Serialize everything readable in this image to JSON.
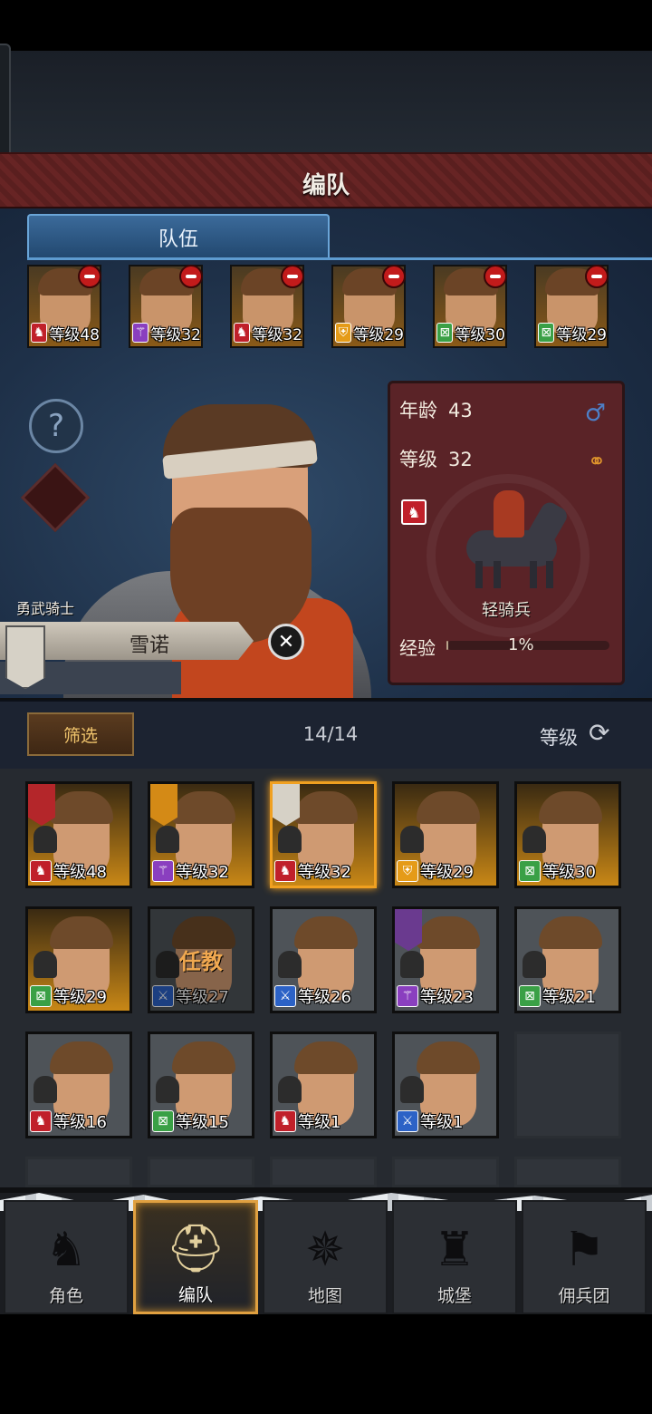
{
  "header": {
    "title": "编队"
  },
  "team_panel": {
    "tab_label": "队伍",
    "slots": [
      {
        "class_icon": "horse-icon",
        "class_color": "#c0202a",
        "level_text": "等级48"
      },
      {
        "class_icon": "staff-icon",
        "class_color": "#8a3fbf",
        "level_text": "等级32"
      },
      {
        "class_icon": "horse-icon",
        "class_color": "#c0202a",
        "level_text": "等级32"
      },
      {
        "class_icon": "shield-icon",
        "class_color": "#e59b18",
        "level_text": "等级29"
      },
      {
        "class_icon": "bow-icon",
        "class_color": "#3aa046",
        "level_text": "等级30"
      },
      {
        "class_icon": "bow-icon",
        "class_color": "#3aa046",
        "level_text": "等级29"
      }
    ],
    "hero": {
      "title": "勇武骑士",
      "name": "雪诺"
    },
    "stats": {
      "age_label": "年龄",
      "age_value": "43",
      "level_label": "等级",
      "level_value": "32",
      "unit_name": "轻骑兵",
      "exp_label": "经验",
      "exp_percent_text": "1%",
      "exp_fraction": 0.01
    }
  },
  "filter": {
    "filter_label": "筛选",
    "count": "14/14",
    "sort_label": "等级"
  },
  "roster": [
    {
      "level_text": "等级48",
      "class_color": "#c0202a",
      "gold": true,
      "emblem": "#b4262a"
    },
    {
      "level_text": "等级32",
      "class_color": "#8a3fbf",
      "gold": true,
      "emblem": "#d48a16"
    },
    {
      "level_text": "等级32",
      "class_color": "#c0202a",
      "gold": true,
      "emblem": "#d6d1c6",
      "selected": true
    },
    {
      "level_text": "等级29",
      "class_color": "#e59b18",
      "gold": true
    },
    {
      "level_text": "等级30",
      "class_color": "#3aa046",
      "gold": true
    },
    {
      "level_text": "等级29",
      "class_color": "#3aa046",
      "gold": true
    },
    {
      "level_text": "等级27",
      "class_color": "#2c62c6",
      "busy": "任教"
    },
    {
      "level_text": "等级26",
      "class_color": "#2c62c6"
    },
    {
      "level_text": "等级23",
      "class_color": "#8a3fbf",
      "emblem": "#6a3a8f"
    },
    {
      "level_text": "等级21",
      "class_color": "#3aa046"
    },
    {
      "level_text": "等级16",
      "class_color": "#c0202a"
    },
    {
      "level_text": "等级15",
      "class_color": "#3aa046"
    },
    {
      "level_text": "等级1",
      "class_color": "#c0202a"
    },
    {
      "level_text": "等级1",
      "class_color": "#2c62c6"
    }
  ],
  "nav": [
    {
      "label": "角色",
      "icon": "knight-icon"
    },
    {
      "label": "编队",
      "icon": "helmet-icon",
      "active": true
    },
    {
      "label": "地图",
      "icon": "compass-icon"
    },
    {
      "label": "城堡",
      "icon": "castle-icon"
    },
    {
      "label": "佣兵团",
      "icon": "banner-icon"
    }
  ]
}
